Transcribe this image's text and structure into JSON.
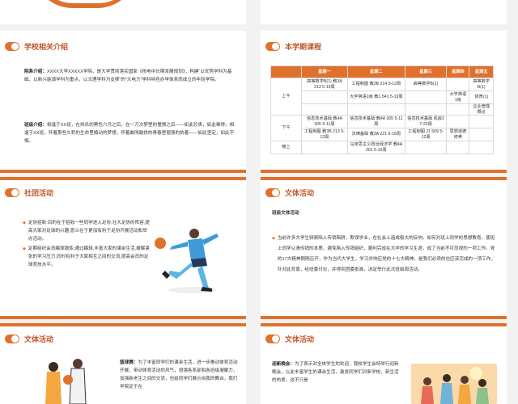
{
  "school": {
    "title": "学校相关介绍",
    "intro_label": "院系介绍：",
    "intro_text": "XXXX大学XXXXX学院，是大学贯彻落实国家《核电中长期发展规划》，构建“以优势学科为基础、以新兴能源学科为重点，以文理学科为支撑”的“大电力”学科特色办学体系而成立的年轻学院。",
    "class_label": "班级介绍：",
    "class_text": "相逢于XX班，在拼杀的黑色六月之后，在一万次梦里的憧憬之后——如此珍贵，如此难得。相逢于XX班，怀着那些久积的生命里煽动的梦想，怀着敢闯敢拼的青春里倔强的执着——如此坚定，如此不悔。"
  },
  "courses": {
    "title": "本学期课程",
    "headers": [
      "",
      "星期一",
      "星期二",
      "星期三",
      "星期四",
      "星期五"
    ],
    "rows": {
      "am": "上午",
      "pm": "下午",
      "eve": "晚上",
      "am1_mon": "高等数学B(1) 教3A 213 5-19周",
      "am1_tue": "工程制图 教3B 214 5-12周",
      "am1_wed": "高等数学B(1)",
      "am1_fri": "高等数学B(1)",
      "am2_tue": "大学英语1级 教1 541 5-19周",
      "am2_thu": "大学英语1级",
      "am2_fri": "体育(1)",
      "am3_fri": "企业管理概论",
      "pm1_mon": "信息技术基础 教4A 305 5-11周",
      "pm1_tue": "信息技术基础 教4A 305 5-11周",
      "pm1_wed": "信息技术基础 机房2 7-20周",
      "pm2_mon": "工程制图 教3B 213 5-12周",
      "pm2_tue": "法律基础 教3A 221 5-16周",
      "pm2_wed": "工程制图 J1 509 5-12周",
      "pm2_thu": "思想道德修养",
      "eve_tue": "马克思主义政治经济学 教4A 301 5-16周"
    }
  },
  "club": {
    "title": "社团活动",
    "b1": "足协招新:目的在于招收一些同学进入足协,壮大足协的阵容,提高大家对足球的兴趣,意义在于更加有利于足协开展活动和举办活动。",
    "b2": "定期组织会员踢球锻炼:通过踢球,丰富大家的课余生活,缓解紧张的学习压力,同时有利于大家相互之间的交流,提高会员的足球竞技水平。"
  },
  "culture1": {
    "title": "文体活动",
    "subtitle": "班级文体活动",
    "b1": "当前许多大学生频频陷入传销陷阱，欺误学业，在社会上造成极大的反响。如何对班上同学的思想教育，使班上同学认清传销的本质，避免陷入传销组织，顺利完成在大学的学习生涯，成了当前不可忽视的一项工作。党的17大精神刚刚召开，作为当代大学生，学习并响应党的十七大精神，是我们必须的也应该完成的一项工作。针对此背景，经班委讨论，并得到团委批准，决定举行此次班级周活动。"
  },
  "culture2": {
    "title": "文体活动",
    "label": "篮球赛：",
    "text": "为了丰富同学们的课余生活，进一步推动体育活动开展，带动体育活动的风气，增强各系部和各班级凝聚力，加强新老生之间的交流，也给同学们展示自我的舞台，我们学院定于在"
  },
  "culture3": {
    "title": "文体活动",
    "label": "迎新晚会：",
    "text": "为了表示对全体学生的欢迎，我校学生会特举行迎新晚会，以此丰富学生的课余生活，激发同学们对新学校，新生活的热爱。这不只是"
  }
}
